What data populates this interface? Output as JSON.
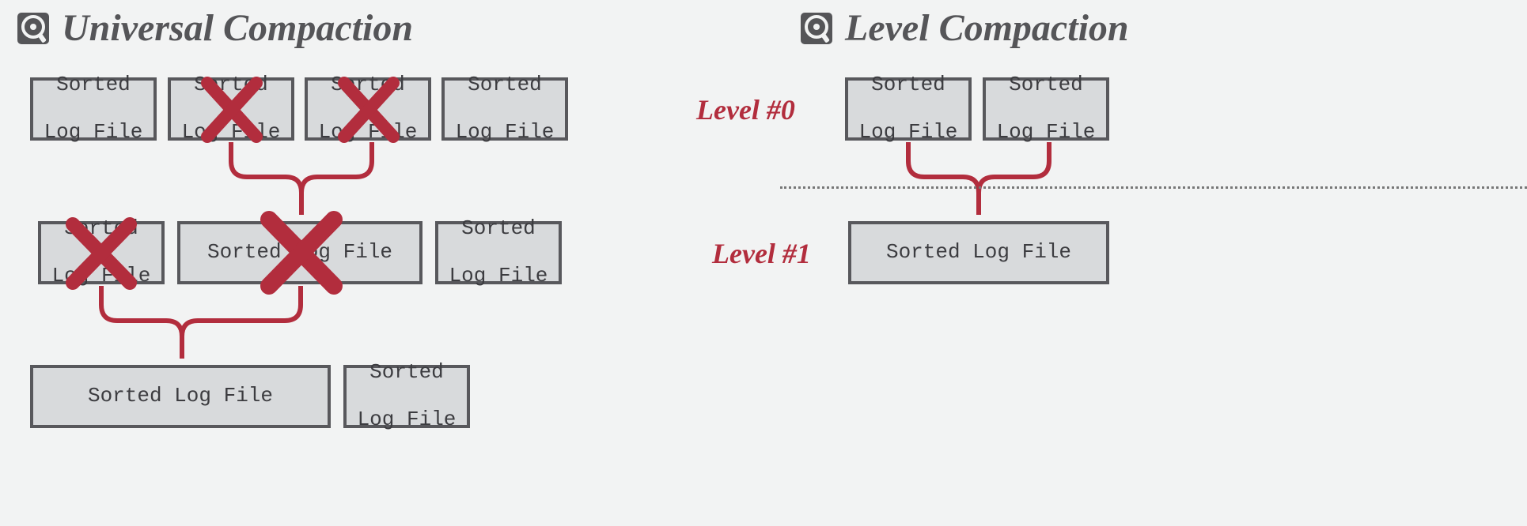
{
  "titles": {
    "left": "Universal Compaction",
    "right": "Level Compaction"
  },
  "file_label": "Sorted Log File",
  "file_label_2l_a": "Sorted",
  "file_label_2l_b": "Log File",
  "levels": {
    "l0": "Level #0",
    "l1": "Level #1"
  },
  "colors": {
    "accent": "#b22d3d",
    "box_border": "#58585c",
    "box_fill": "#d8dadc",
    "title": "#555558",
    "bg": "#f2f3f3"
  },
  "diagram": {
    "universal": {
      "row1": [
        {
          "crossed": false
        },
        {
          "crossed": true
        },
        {
          "crossed": true
        },
        {
          "crossed": false
        }
      ],
      "row2": [
        {
          "crossed": true,
          "size": "small"
        },
        {
          "crossed": true,
          "size": "wide"
        },
        {
          "crossed": false,
          "size": "small"
        }
      ],
      "row3": [
        {
          "crossed": false,
          "size": "xwide"
        },
        {
          "crossed": false,
          "size": "small"
        }
      ],
      "merges": [
        {
          "from": [
            "row1[1]",
            "row1[2]"
          ],
          "to": "row2[1]"
        },
        {
          "from": [
            "row2[0]",
            "row2[1]"
          ],
          "to": "row3[0]"
        }
      ]
    },
    "level": {
      "row1": [
        {
          "crossed": false
        },
        {
          "crossed": false
        }
      ],
      "row2": [
        {
          "crossed": false,
          "size": "wide"
        }
      ],
      "merges": [
        {
          "from": [
            "row1[0]",
            "row1[1]"
          ],
          "to": "row2[0]"
        }
      ]
    }
  }
}
